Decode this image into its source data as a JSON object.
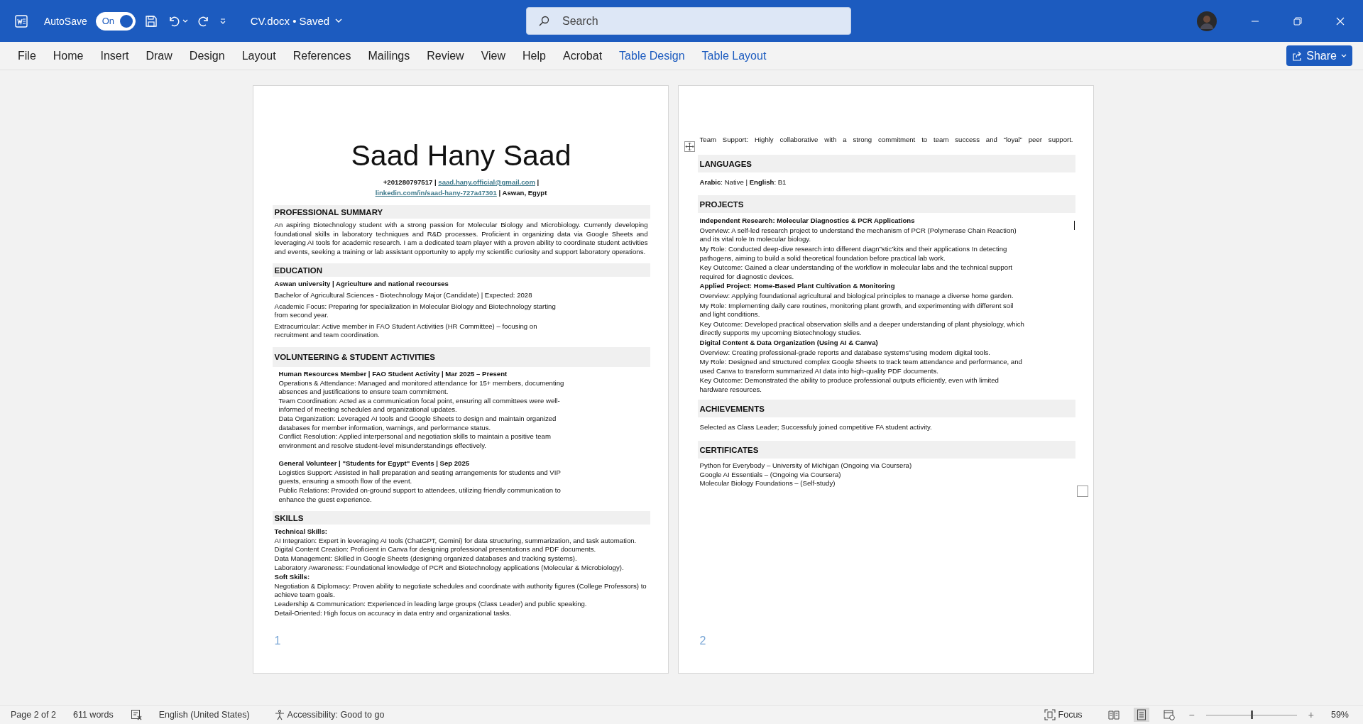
{
  "title_bar": {
    "autosave_label": "AutoSave",
    "autosave_toggle": {
      "label": "On",
      "on": true
    },
    "document_name": "CV.docx",
    "separator": "•",
    "save_status": "Saved",
    "search": {
      "placeholder": "Search"
    }
  },
  "ribbon_tabs": [
    {
      "label": "File",
      "selected": false,
      "kind": "normal"
    },
    {
      "label": "Home",
      "selected": false,
      "kind": "normal"
    },
    {
      "label": "Insert",
      "selected": false,
      "kind": "normal"
    },
    {
      "label": "Draw",
      "selected": false,
      "kind": "normal"
    },
    {
      "label": "Design",
      "selected": false,
      "kind": "normal"
    },
    {
      "label": "Layout",
      "selected": false,
      "kind": "normal"
    },
    {
      "label": "References",
      "selected": false,
      "kind": "normal"
    },
    {
      "label": "Mailings",
      "selected": false,
      "kind": "normal"
    },
    {
      "label": "Review",
      "selected": false,
      "kind": "normal"
    },
    {
      "label": "View",
      "selected": false,
      "kind": "normal"
    },
    {
      "label": "Help",
      "selected": false,
      "kind": "normal"
    },
    {
      "label": "Acrobat",
      "selected": false,
      "kind": "normal"
    },
    {
      "label": "Table Design",
      "selected": false,
      "kind": "contextual"
    },
    {
      "label": "Table Layout",
      "selected": false,
      "kind": "contextual"
    }
  ],
  "share_button": "Share",
  "pages": [
    {
      "header": {
        "name": "Saad Hany Saad",
        "contact_lines": [
          [
            {
              "text": "+201280797517 | ",
              "link": false
            },
            {
              "text": "saad.hany.official@gmail.com",
              "link": true
            },
            {
              "text": " |",
              "link": false
            }
          ],
          [
            {
              "text": "linkedin.com/in/saad-hany-727a47301",
              "link": true
            },
            {
              "text": " | Aswan, Egypt",
              "link": false
            }
          ]
        ]
      },
      "sections": [
        {
          "heading": "PROFESSIONAL SUMMARY",
          "items": [
            {
              "kind": "paragraph",
              "text": "An aspiring Biotechnology student with a strong passion for Molecular Biology and Microbiology. Currently developing foundational skills in laboratory techniques and R&D processes. Proficient in organizing data via Google Sheets and leveraging AI tools for academic research. I am a dedicated team player with a proven ability to coordinate student activities and events, seeking a training or lab assistant opportunity to apply my scientific curiosity and support laboratory operations."
            }
          ]
        },
        {
          "heading": "EDUCATION",
          "items": [
            {
              "kind": "bold",
              "text": "Aswan university | Agriculture and national recourses"
            },
            {
              "kind": "text",
              "text": "Bachelor of Agricultural Sciences - Biotechnology Major (Candidate) | Expected: 2028"
            },
            {
              "kind": "text",
              "text": "Academic Focus: Preparing for specialization in Molecular Biology and Biotechnology starting from second year."
            },
            {
              "kind": "text",
              "text": "Extracurricular: Active member in FAO Student Activities (HR Committee) – focusing on recruitment and team coordination."
            }
          ]
        },
        {
          "heading": "VOLUNTEERING & STUDENT ACTIVITIES",
          "items": [
            {
              "kind": "entry",
              "title": "Human Resources Member | FAO Student Activity | Mar 2025 – Present",
              "lines": [
                "Operations & Attendance: Managed and monitored attendance for 15+ members, documenting absences and justifications to ensure team commitment.",
                "Team Coordination: Acted as a communication focal point, ensuring all committees were well-informed of meeting schedules and organizational updates.",
                "Data Organization: Leveraged AI tools and Google Sheets to design and maintain organized databases for member information, warnings, and performance status.",
                "Conflict Resolution: Applied interpersonal and negotiation skills to maintain a positive team environment and resolve student-level misunderstandings effectively."
              ]
            },
            {
              "kind": "entry",
              "title": "General Volunteer | \"Students for Egypt\" Events | Sep 2025",
              "lines": [
                "Logistics Support: Assisted in hall preparation and seating arrangements for students and VIP guests, ensuring a smooth flow of the event.",
                "Public Relations: Provided on-ground support to attendees, utilizing friendly communication to enhance the guest experience."
              ]
            }
          ]
        },
        {
          "heading": "SKILLS",
          "items": [
            {
              "kind": "bold",
              "text": "Technical Skills:"
            },
            {
              "kind": "line",
              "text": "AI Integration: Expert in leveraging AI tools (ChatGPT, Gemini) for data structuring, summarization, and task automation."
            },
            {
              "kind": "line",
              "text": "Digital Content Creation: Proficient in Canva for designing professional presentations and PDF documents."
            },
            {
              "kind": "line",
              "text": "Data Management: Skilled in Google Sheets (designing organized databases and tracking systems)."
            },
            {
              "kind": "line",
              "text": "Laboratory Awareness: Foundational knowledge of PCR and Biotechnology applications (Molecular & Microbiology)."
            },
            {
              "kind": "bold",
              "text": "Soft Skills:"
            },
            {
              "kind": "line",
              "text": "Negotiation & Diplomacy: Proven ability to negotiate schedules and coordinate with authority figures (College Professors) to achieve team goals."
            },
            {
              "kind": "line",
              "text": "Leadership & Communication: Experienced in leading large groups (Class Leader) and public speaking."
            },
            {
              "kind": "line",
              "text": "Detail-Oriented: High focus on accuracy in data entry and organizational tasks."
            }
          ]
        }
      ],
      "page_number": "1"
    },
    {
      "lead": "Team Support: Highly collaborative with a strong commitment to team success and “loyal” peer support.",
      "table": true,
      "sections": [
        {
          "heading": "LANGUAGES",
          "items": [
            {
              "kind": "spaced",
              "text": "**Arabic**: Native | **English**: B1"
            }
          ]
        },
        {
          "heading": "PROJECTS",
          "items": [
            {
              "kind": "bold",
              "text": "Independent Research: Molecular Diagnostics & PCR Applications"
            },
            {
              "kind": "text",
              "text": "Overview: A self-led research project to understand the mechanism of PCR (Polymerase Chain Reaction) and its vital role In molecular biology."
            },
            {
              "kind": "text",
              "text": "My Role: Conducted deep-dive research into different diagn”stic’kits and their applications In detecting pathogens, aiming to build a solid theoretical foundation before practical lab work."
            },
            {
              "kind": "text",
              "text": "Key Outcome: Gained a clear understanding of the workflow in molecular labs and the technical support required for diagnostic devices."
            },
            {
              "kind": "bold",
              "text": "Applied Project: Home-Based Plant Cultivation & Monitoring"
            },
            {
              "kind": "text",
              "text": "Overview: Applying foundational agricultural and biological principles to manage a diverse home garden."
            },
            {
              "kind": "text",
              "text": "My Role: Implementing daily care routines, monitoring plant growth, and experimenting with different soil and light conditions."
            },
            {
              "kind": "text",
              "text": "Key Outcome: Developed practical observation skills and a deeper understanding of plant physiology, which directly supports my upcoming Biotechnology studies."
            },
            {
              "kind": "bold",
              "text": "Digital Content & Data Organization (Using AI & Canva)"
            },
            {
              "kind": "text",
              "text": "Overview: Creating professional-grade reports and database systems”using modern digital tools."
            },
            {
              "kind": "text",
              "text": "My Role: Designed and structured complex Google Sheets to track team attendance and performance, and used Canva to transform summarized AI data into high-quality PDF documents."
            },
            {
              "kind": "text",
              "text": "Key Outcome: Demonstrated the ability to produce professional outputs efficiently, even with limited hardware resources."
            }
          ]
        },
        {
          "heading": "ACHIEVEMENTS",
          "items": [
            {
              "kind": "spaced",
              "text": "Selected as Class Leader; Successfuly joined competitive FA student activity."
            }
          ]
        },
        {
          "heading": "CERTIFICATES",
          "items": [
            {
              "kind": "line",
              "text": "Python for Everybody – University of Michigan (Ongoing via Coursera)"
            },
            {
              "kind": "line",
              "text": "Google AI Essentials – (Ongoing via Coursera)"
            },
            {
              "kind": "line",
              "text": "Molecular Biology Foundations – (Self-study)"
            }
          ]
        }
      ],
      "page_number": "2"
    }
  ],
  "status_bar": {
    "page": "Page 2 of 2",
    "words": "611 words",
    "language": "English (United States)",
    "accessibility": "Accessibility: Good to go",
    "focus": "Focus",
    "view_buttons": [
      {
        "kind": "read",
        "selected": false
      },
      {
        "kind": "print",
        "selected": true
      },
      {
        "kind": "web",
        "selected": false
      }
    ],
    "zoom": {
      "level": 0.5,
      "reading": "59%",
      "out_label": "−",
      "in_label": "+"
    }
  }
}
